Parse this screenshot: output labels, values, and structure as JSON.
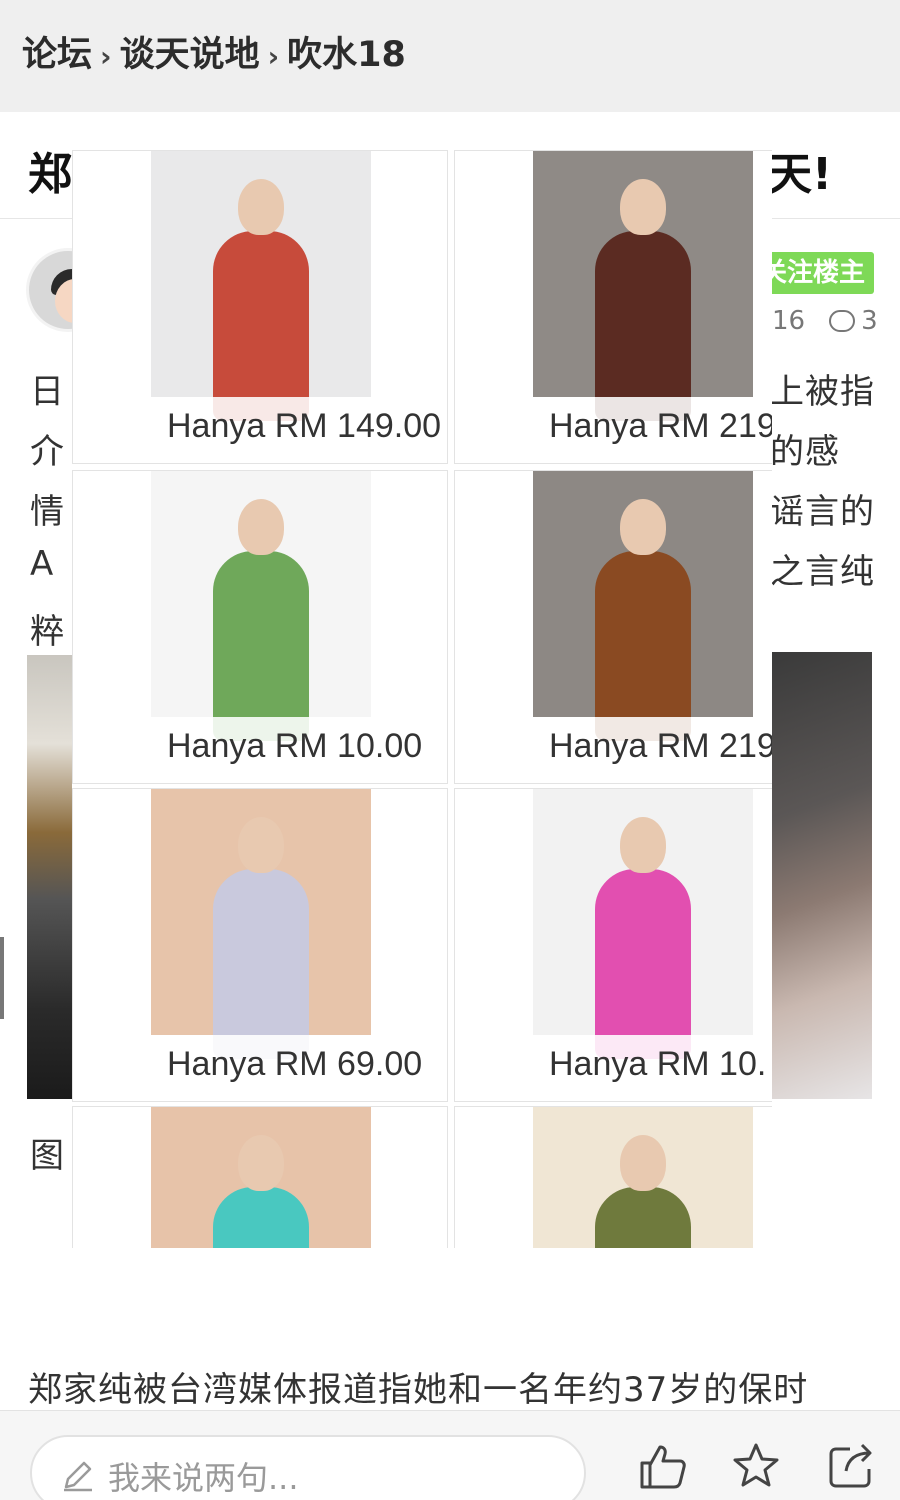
{
  "breadcrumb": {
    "items": [
      "论坛",
      "谈天说地",
      "吹水18"
    ],
    "separator": "›"
  },
  "post": {
    "title_partial_left": "郑",
    "title_partial_right": "天!",
    "follow_label": "关注楼主",
    "views": "16",
    "comments": "3",
    "body_left_fragments": [
      "日",
      "介",
      "情",
      "A",
      "粹"
    ],
    "body_right_fragments": [
      "上被指",
      "的感",
      "谣言的",
      "之言纯"
    ],
    "caption_fragment": "图",
    "bottom_paragraph": "郑家纯被台湾媒体报道指她和一名年约37岁的保时"
  },
  "ad_overlay": {
    "products": [
      {
        "price": "Hanya RM 149.00",
        "colors": [
          "#e9e9ea",
          "#c74b3b"
        ]
      },
      {
        "price": "Hanya RM 219.",
        "colors": [
          "#8f8a86",
          "#5b2b22"
        ]
      },
      {
        "price": "Hanya RM 10.00",
        "colors": [
          "#f5f5f5",
          "#6fa85a"
        ]
      },
      {
        "price": "Hanya RM 219.",
        "colors": [
          "#8d8884",
          "#8a4a22"
        ]
      },
      {
        "price": "Hanya RM 69.00",
        "colors": [
          "#e7c4aa",
          "#c9c9dd"
        ]
      },
      {
        "price": "Hanya RM 10.",
        "colors": [
          "#f2f2f2",
          "#e24fb0"
        ]
      },
      {
        "price": "",
        "colors": [
          "#e7c3a9",
          "#49c8c0"
        ]
      },
      {
        "price": "",
        "colors": [
          "#f0e6d4",
          "#6f7a3d"
        ]
      }
    ]
  },
  "bottom_bar": {
    "reply_placeholder": "我来说两句...",
    "icons": [
      "pencil-icon",
      "thumbs-up-icon",
      "star-icon",
      "share-icon"
    ]
  }
}
